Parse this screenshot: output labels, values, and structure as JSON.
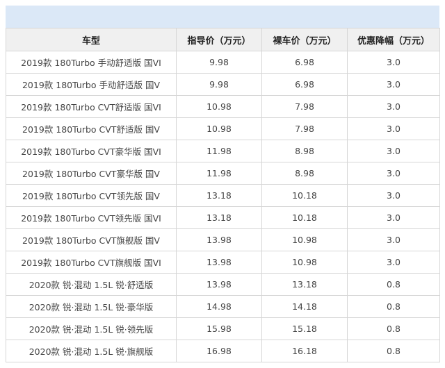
{
  "table": {
    "headers": [
      "车型",
      "指导价（万元）",
      "裸车价（万元）",
      "优惠降幅（万元）"
    ],
    "rows": [
      [
        "2019款 180Turbo 手动舒适版 国VI",
        "9.98",
        "6.98",
        "3.0"
      ],
      [
        "2019款 180Turbo 手动舒适版 国V",
        "9.98",
        "6.98",
        "3.0"
      ],
      [
        "2019款 180Turbo CVT舒适版 国VI",
        "10.98",
        "7.98",
        "3.0"
      ],
      [
        "2019款 180Turbo CVT舒适版 国V",
        "10.98",
        "7.98",
        "3.0"
      ],
      [
        "2019款 180Turbo CVT豪华版 国VI",
        "11.98",
        "8.98",
        "3.0"
      ],
      [
        "2019款 180Turbo CVT豪华版 国V",
        "11.98",
        "8.98",
        "3.0"
      ],
      [
        "2019款 180Turbo CVT领先版 国V",
        "13.18",
        "10.18",
        "3.0"
      ],
      [
        "2019款 180Turbo CVT领先版 国VI",
        "13.18",
        "10.18",
        "3.0"
      ],
      [
        "2019款 180Turbo CVT旗舰版 国V",
        "13.98",
        "10.98",
        "3.0"
      ],
      [
        "2019款 180Turbo CVT旗舰版 国VI",
        "13.98",
        "10.98",
        "3.0"
      ],
      [
        "2020款 锐·混动 1.5L 锐·舒适版",
        "13.98",
        "13.18",
        "0.8"
      ],
      [
        "2020款 锐·混动 1.5L 锐·豪华版",
        "14.98",
        "14.18",
        "0.8"
      ],
      [
        "2020款 锐·混动 1.5L 锐·领先版",
        "15.98",
        "15.18",
        "0.8"
      ],
      [
        "2020款 锐·混动 1.5L 锐·旗舰版",
        "16.98",
        "16.18",
        "0.8"
      ]
    ]
  }
}
